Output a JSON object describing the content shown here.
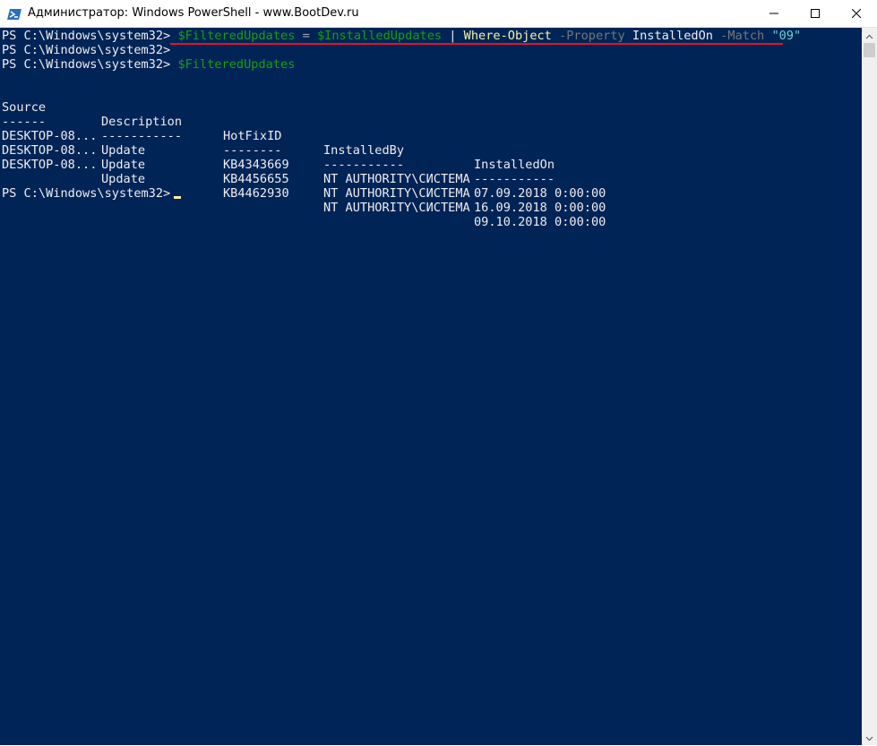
{
  "window": {
    "title": "Администратор: Windows PowerShell - www.BootDev.ru",
    "controls": {
      "minimize": "minimize-icon",
      "maximize": "maximize-icon",
      "close": "close-icon"
    }
  },
  "console": {
    "prompt": "PS C:\\Windows\\system32>",
    "cmd1": {
      "var1": "$FilteredUpdates",
      "eq": "=",
      "var2": "$InstalledUpdates",
      "pipe": "|",
      "cmdlet": "Where-Object",
      "param1": "-Property",
      "arg1": "InstalledOn",
      "param2": "-Match",
      "str": "\"09\""
    },
    "cmd3": {
      "var": "$FilteredUpdates"
    },
    "table": {
      "headers": [
        "Source",
        "Description",
        "HotFixID",
        "InstalledBy",
        "InstalledOn"
      ],
      "separators": [
        "------",
        "-----------",
        "--------",
        "-----------",
        "-----------"
      ],
      "rows": [
        [
          "DESKTOP-08...",
          "Update",
          "KB4343669",
          "NT AUTHORITY\\СИСТЕМА",
          "07.09.2018 0:00:00"
        ],
        [
          "DESKTOP-08...",
          "Update",
          "KB4456655",
          "NT AUTHORITY\\СИСТЕМА",
          "16.09.2018 0:00:00"
        ],
        [
          "DESKTOP-08...",
          "Update",
          "KB4462930",
          "NT AUTHORITY\\СИСТЕМА",
          "09.10.2018 0:00:00"
        ]
      ]
    }
  },
  "colors": {
    "background": "#012456",
    "variable": "#13a10e",
    "cmdlet": "#f9f1a5",
    "parameter": "#767676",
    "string": "#61d6d6",
    "highlight_underline": "#e81123"
  }
}
